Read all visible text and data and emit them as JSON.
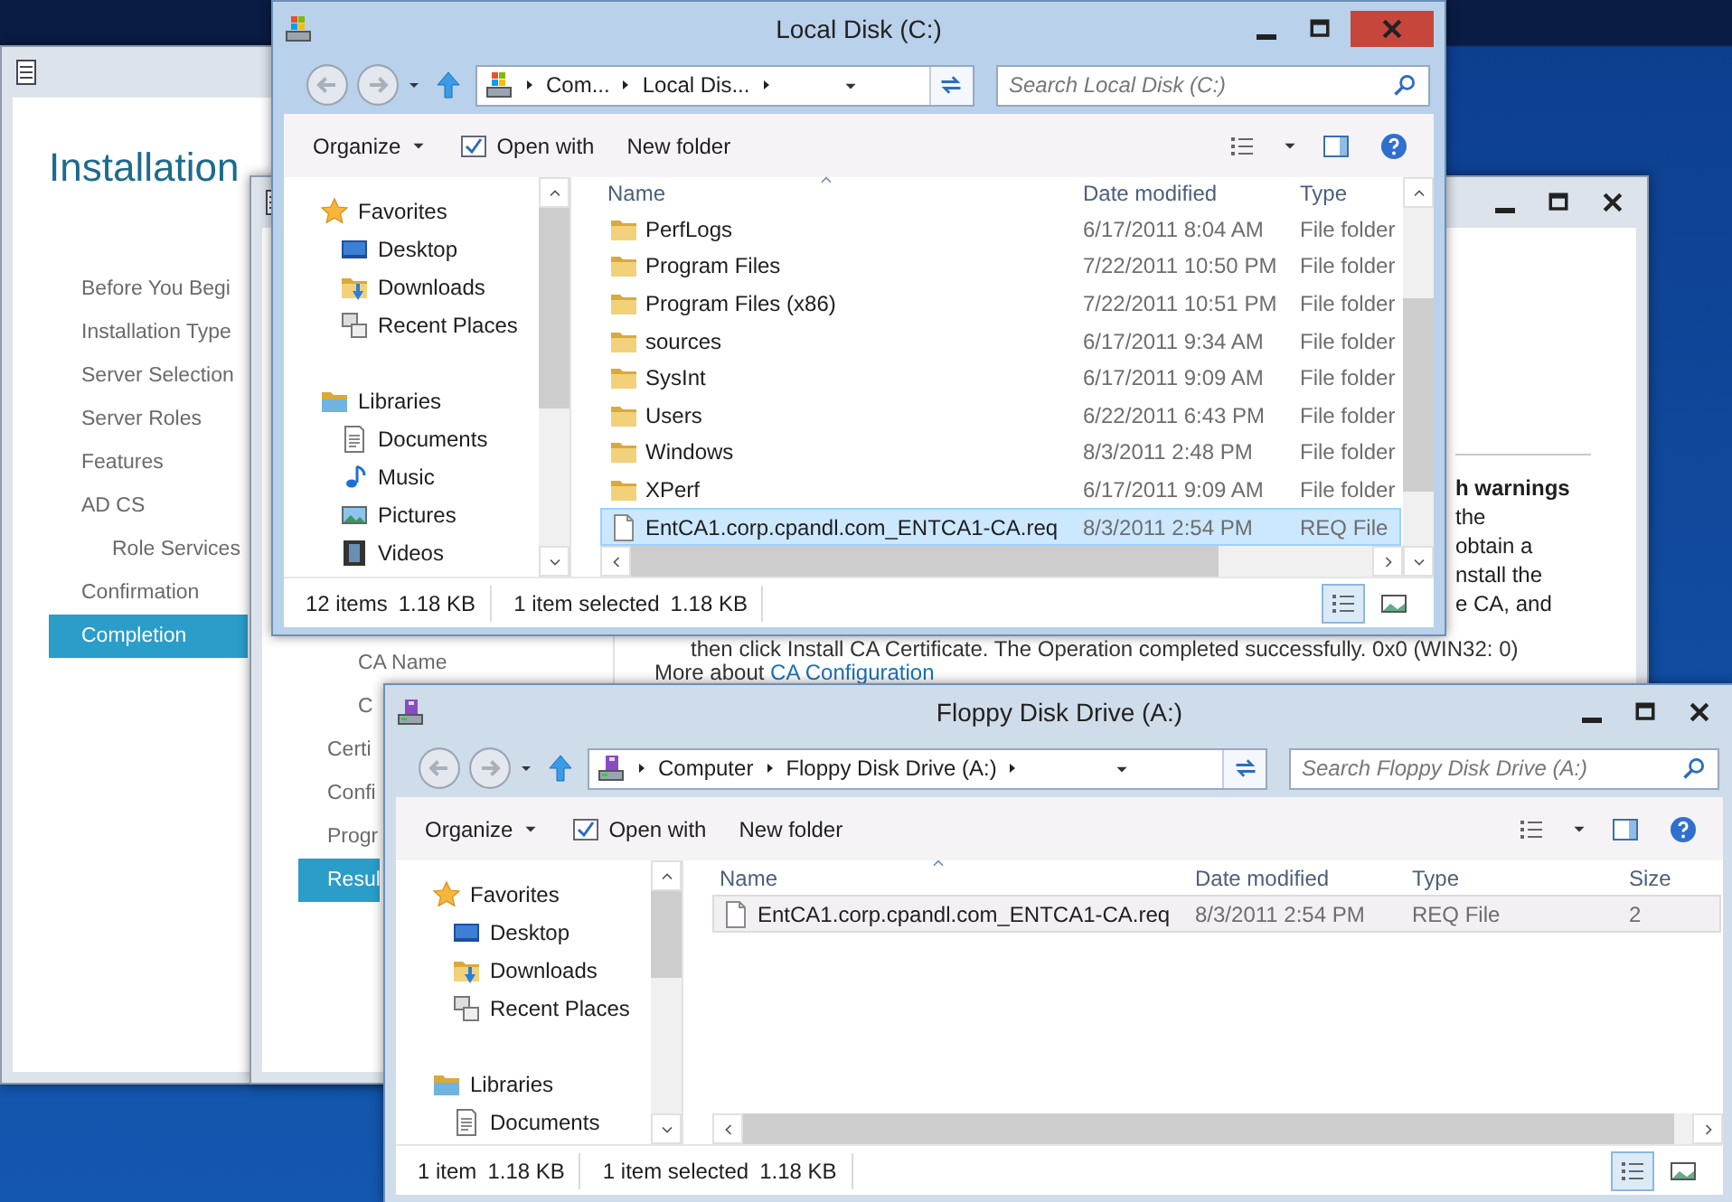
{
  "setup_wizard": {
    "heading": "Installation",
    "steps": [
      {
        "label": "Before You Begi",
        "selected": false
      },
      {
        "label": "Installation Type",
        "selected": false
      },
      {
        "label": "Server Selection",
        "selected": false
      },
      {
        "label": "Server Roles",
        "selected": false
      },
      {
        "label": "Features",
        "selected": false
      },
      {
        "label": "AD CS",
        "selected": false,
        "children": [
          {
            "label": "Role Services",
            "selected": false
          }
        ]
      },
      {
        "label": "Confirmation",
        "selected": false
      },
      {
        "label": "Completion",
        "selected": true
      }
    ]
  },
  "configuration_wizard": {
    "steps": [
      {
        "label": "CA Name",
        "selected": false,
        "kind": "sub"
      },
      {
        "label": "C",
        "selected": false,
        "kind": "sub"
      },
      {
        "label": "Certi",
        "selected": false,
        "kind": "main"
      },
      {
        "label": "Confi",
        "selected": false,
        "kind": "main"
      },
      {
        "label": "Progr",
        "selected": false,
        "kind": "main"
      },
      {
        "label": "Resul",
        "selected": true,
        "kind": "main"
      }
    ],
    "result_heading": "h warnings",
    "result_lines": [
      "the",
      "obtain a",
      "nstall the",
      "e CA, and"
    ],
    "result_detail": "then click Install CA Certificate. The Operation completed successfully. 0x0 (WIN32: 0)",
    "more_about": "More about",
    "more_about_link": "CA Configuration"
  },
  "explorer_windows": [
    {
      "title": "Local Disk (C:)",
      "active": true,
      "kind": "hard_disk",
      "breadcrumb": [
        "Com...",
        "Local Dis..."
      ],
      "search_placeholder": "Search Local Disk (C:)",
      "toolbar": [
        {
          "label": "Organize",
          "kind": "menu"
        },
        {
          "label": "Open with",
          "kind": "icon"
        },
        {
          "label": "New folder",
          "kind": "plain"
        }
      ],
      "nav_groups": [
        {
          "label": "Favorites",
          "kind": "favorites",
          "children": [
            {
              "label": "Desktop",
              "kind": "desktop"
            },
            {
              "label": "Downloads",
              "kind": "downloads"
            },
            {
              "label": "Recent Places",
              "kind": "recent"
            }
          ]
        },
        {
          "label": "Libraries",
          "kind": "libraries",
          "children": [
            {
              "label": "Documents",
              "kind": "documents"
            },
            {
              "label": "Music",
              "kind": "music"
            },
            {
              "label": "Pictures",
              "kind": "pictures"
            },
            {
              "label": "Videos",
              "kind": "videos"
            }
          ]
        }
      ],
      "columns": [
        "Name",
        "Date modified",
        "Type"
      ],
      "files": [
        {
          "name": "PerfLogs",
          "date": "6/17/2011 8:04 AM",
          "type": "File folder",
          "kind": "folder",
          "selected": false
        },
        {
          "name": "Program Files",
          "date": "7/22/2011 10:50 PM",
          "type": "File folder",
          "kind": "folder",
          "selected": false
        },
        {
          "name": "Program Files (x86)",
          "date": "7/22/2011 10:51 PM",
          "type": "File folder",
          "kind": "folder",
          "selected": false
        },
        {
          "name": "sources",
          "date": "6/17/2011 9:34 AM",
          "type": "File folder",
          "kind": "folder",
          "selected": false
        },
        {
          "name": "SysInt",
          "date": "6/17/2011 9:09 AM",
          "type": "File folder",
          "kind": "folder",
          "selected": false
        },
        {
          "name": "Users",
          "date": "6/22/2011 6:43 PM",
          "type": "File folder",
          "kind": "folder",
          "selected": false
        },
        {
          "name": "Windows",
          "date": "8/3/2011 2:48 PM",
          "type": "File folder",
          "kind": "folder",
          "selected": false
        },
        {
          "name": "XPerf",
          "date": "6/17/2011 9:09 AM",
          "type": "File folder",
          "kind": "folder",
          "selected": false
        },
        {
          "name": "EntCA1.corp.cpandl.com_ENTCA1-CA.req",
          "date": "8/3/2011 2:54 PM",
          "type": "REQ File",
          "kind": "file",
          "selected": true
        }
      ],
      "status": [
        {
          "count": "12 items",
          "size": "1.18 KB"
        },
        {
          "count": "1 item selected",
          "size": "1.18 KB"
        }
      ]
    },
    {
      "title": "Floppy Disk Drive (A:)",
      "active": false,
      "kind": "floppy",
      "breadcrumb": [
        "Computer",
        "Floppy Disk Drive (A:)"
      ],
      "search_placeholder": "Search Floppy Disk Drive (A:)",
      "toolbar": [
        {
          "label": "Organize",
          "kind": "menu"
        },
        {
          "label": "Open with",
          "kind": "icon"
        },
        {
          "label": "New folder",
          "kind": "plain"
        }
      ],
      "nav_groups": [
        {
          "label": "Favorites",
          "kind": "favorites",
          "children": [
            {
              "label": "Desktop",
              "kind": "desktop"
            },
            {
              "label": "Downloads",
              "kind": "downloads"
            },
            {
              "label": "Recent Places",
              "kind": "recent"
            }
          ]
        },
        {
          "label": "Libraries",
          "kind": "libraries",
          "children": [
            {
              "label": "Documents",
              "kind": "documents"
            }
          ]
        }
      ],
      "columns": [
        "Name",
        "Date modified",
        "Type",
        "Size"
      ],
      "files": [
        {
          "name": "EntCA1.corp.cpandl.com_ENTCA1-CA.req",
          "date": "8/3/2011 2:54 PM",
          "type": "REQ File",
          "size": "2",
          "kind": "file",
          "selected": true
        }
      ],
      "status": [
        {
          "count": "1 item",
          "size": "1.18 KB"
        },
        {
          "count": "1 item selected",
          "size": "1.18 KB"
        }
      ]
    }
  ]
}
